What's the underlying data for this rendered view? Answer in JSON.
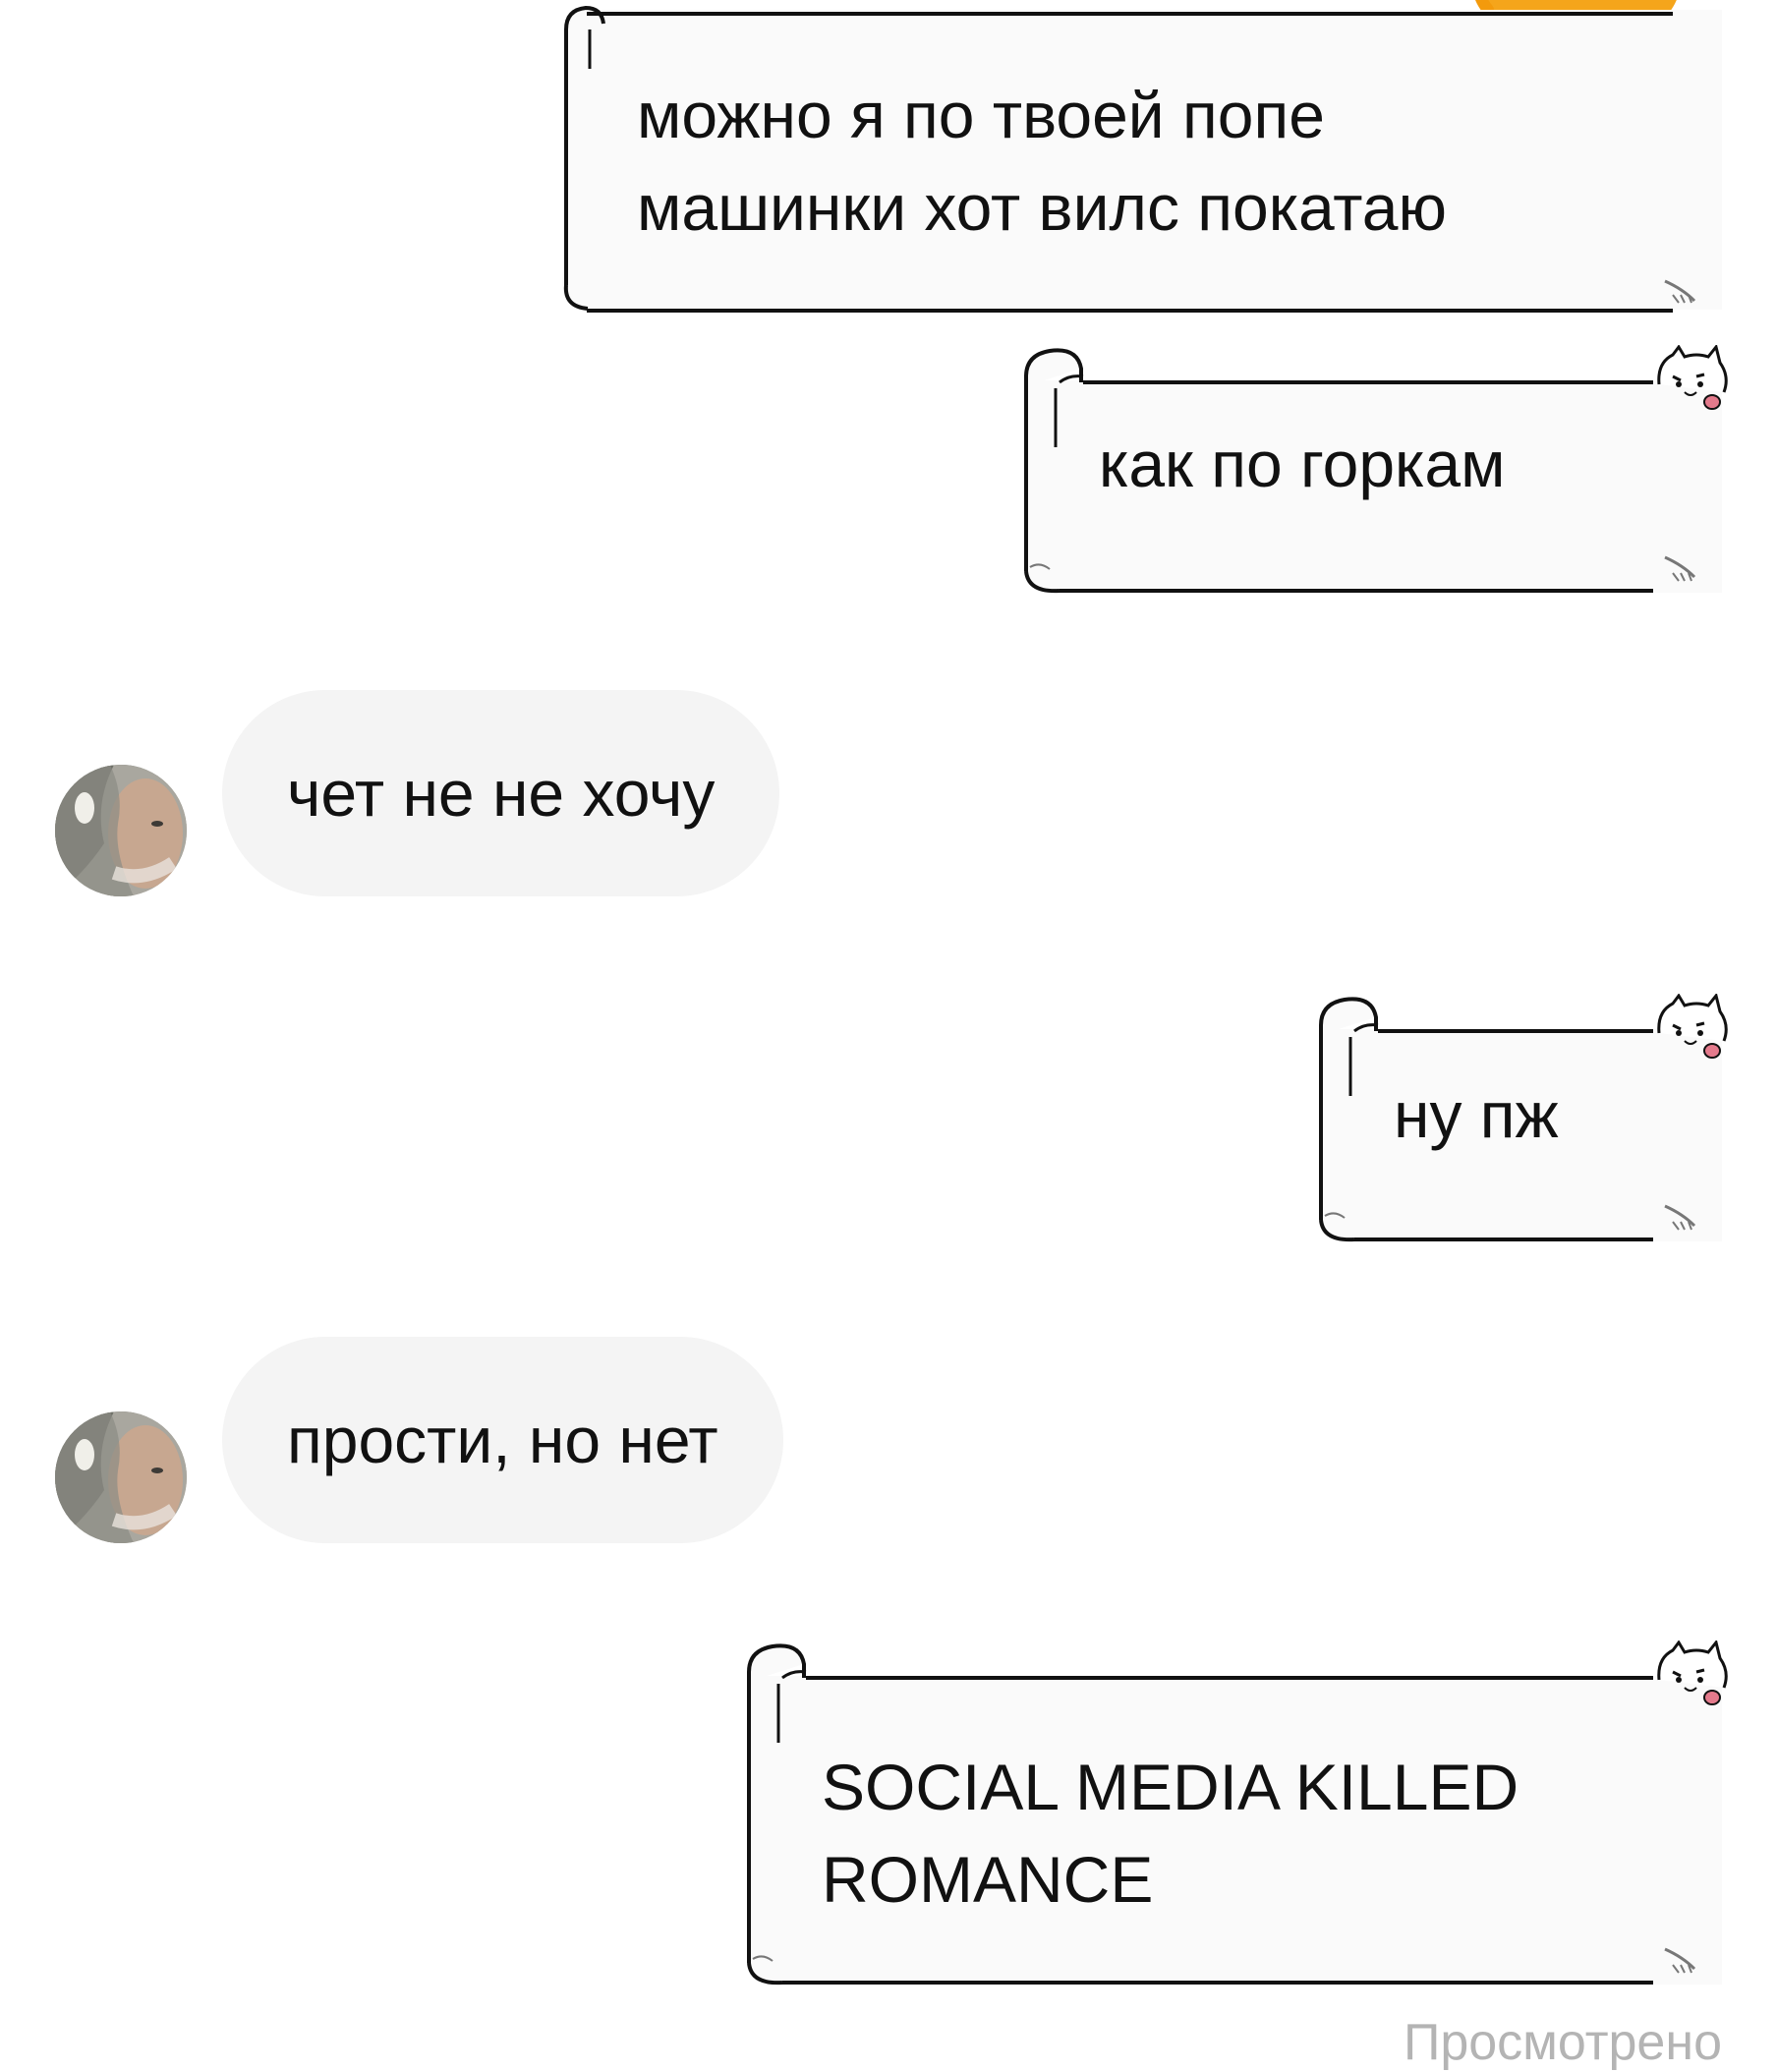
{
  "messages": [
    {
      "direction": "outgoing",
      "style": "scroll",
      "lines": [
        "можно я по твоей попе",
        "машинки хот вилс покатаю"
      ]
    },
    {
      "direction": "outgoing",
      "style": "scroll",
      "lines": [
        "как по горкам"
      ]
    },
    {
      "direction": "incoming",
      "style": "pill",
      "text": "чет не не хочу"
    },
    {
      "direction": "outgoing",
      "style": "scroll",
      "lines": [
        "ну пж"
      ]
    },
    {
      "direction": "incoming",
      "style": "pill",
      "text": "прости, но нет"
    },
    {
      "direction": "outgoing",
      "style": "scroll",
      "lines": [
        "SOCIAL MEDIA KILLED",
        "ROMANCE"
      ]
    }
  ],
  "status": {
    "seen_label": "Просмотрено"
  },
  "colors": {
    "incoming_bubble": "#f4f4f4",
    "outgoing_bubble": "#fafafa",
    "scroll_outline": "#111111",
    "mascot": "#f5a51b",
    "seen_text": "#b4b4b4"
  },
  "icons": {
    "avatar": "user-avatar-photo",
    "scroll_decor": "cat-face-icon",
    "sticker": "orange-mascot-sticker"
  }
}
